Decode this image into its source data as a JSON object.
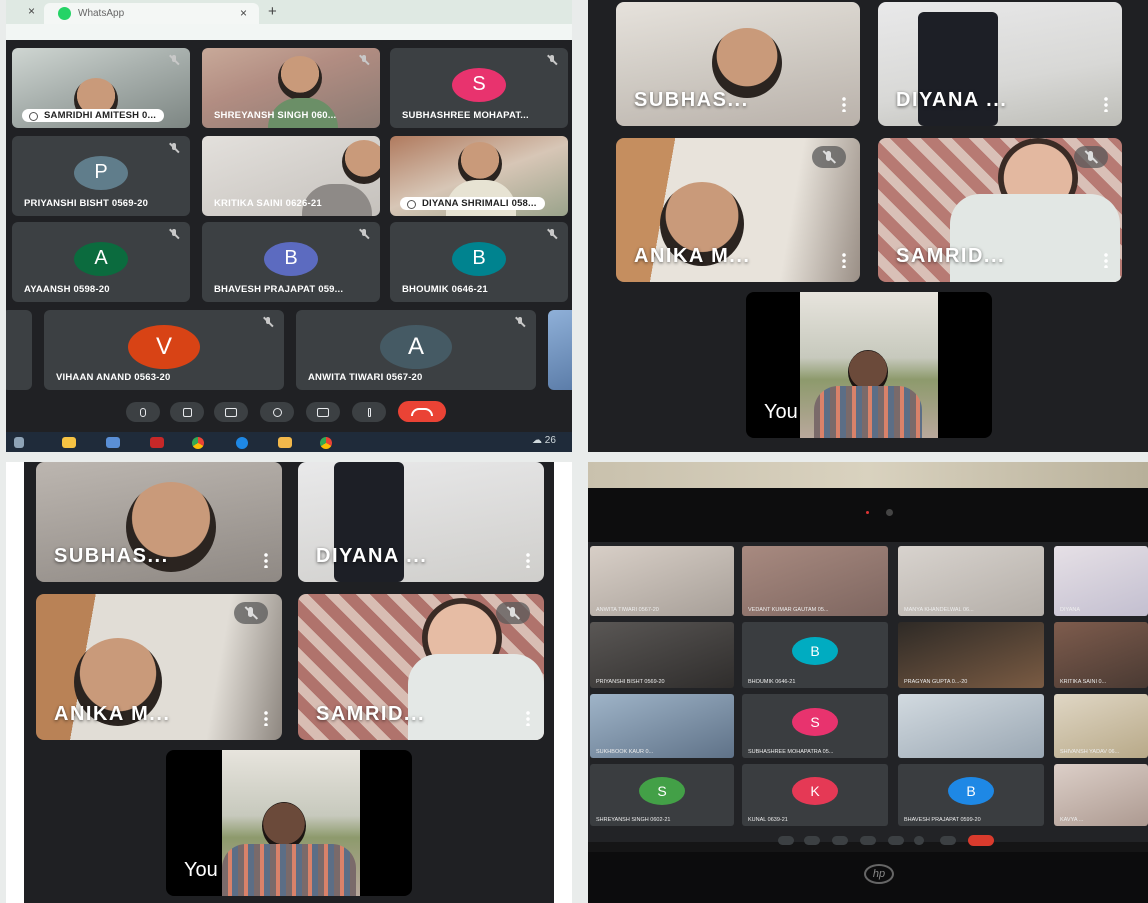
{
  "browser": {
    "tab_title": "WhatsApp",
    "new_tab": "+",
    "close_tab": "×"
  },
  "meet_grid": {
    "participants": [
      {
        "name": "SAMRIDHI AMITESH 0...",
        "avatar": "",
        "color": ""
      },
      {
        "name": "SHREYANSH SINGH 060...",
        "avatar": "",
        "color": ""
      },
      {
        "name": "SUBHASHREE MOHAPAT...",
        "avatar": "S",
        "color": "#e8336e"
      },
      {
        "name": "PRIYANSHI BISHT 0569-20",
        "avatar": "P",
        "color": "#607d8b"
      },
      {
        "name": "KRITIKA SAINI 0626-21",
        "avatar": "",
        "color": ""
      },
      {
        "name": "DIYANA SHRIMALI 058...",
        "avatar": "",
        "color": ""
      },
      {
        "name": "AYAANSH 0598-20",
        "avatar": "A",
        "color": "#0b6b3e"
      },
      {
        "name": "BHAVESH PRAJAPAT 059...",
        "avatar": "B",
        "color": "#5c6bc0"
      },
      {
        "name": "BHOUMIK 0646-21",
        "avatar": "B",
        "color": "#00838f"
      },
      {
        "name": "VIHAAN ANAND 0563-20",
        "avatar": "V",
        "color": "#d84315"
      },
      {
        "name": "ANWITA TIWARI 0567-20",
        "avatar": "A",
        "color": "#455a64"
      }
    ],
    "taskbar_weather": "26"
  },
  "phone_a": {
    "tiles": [
      {
        "name": "SUBHAS..."
      },
      {
        "name": "DIYANA ..."
      },
      {
        "name": "ANIKA M..."
      },
      {
        "name": "SAMRID..."
      }
    ],
    "self_label": "You"
  },
  "phone_b": {
    "tiles": [
      {
        "name": "SUBHAS..."
      },
      {
        "name": "DIYANA ..."
      },
      {
        "name": "ANIKA M..."
      },
      {
        "name": "SAMRID..."
      }
    ],
    "self_label": "You"
  },
  "laptop": {
    "participants": [
      {
        "name": "ANWITA TIWARI 0567-20",
        "avatar": ""
      },
      {
        "name": "VEDANT KUMAR GAUTAM 05...",
        "avatar": ""
      },
      {
        "name": "MANYA KHANDELWAL 06...",
        "avatar": ""
      },
      {
        "name": "DIYANA",
        "avatar": ""
      },
      {
        "name": "PRIYANSHI BISHT 0569-20",
        "avatar": ""
      },
      {
        "name": "BHOUMIK 0646-21",
        "avatar": "B"
      },
      {
        "name": "PRAGYAN GUPTA 0...-20",
        "avatar": ""
      },
      {
        "name": "KRITIKA SAINI 0...",
        "avatar": ""
      },
      {
        "name": "SUKHBOOK KAUR 0...",
        "avatar": ""
      },
      {
        "name": "SUBHASHREE MOHAPATRA 05...",
        "avatar": "S"
      },
      {
        "name": "",
        "avatar": ""
      },
      {
        "name": "SHIVANSH YADAV 06...",
        "avatar": ""
      },
      {
        "name": "SHREYANSH SINGH 0602-21",
        "avatar": "S"
      },
      {
        "name": "KUNAL 0639-21",
        "avatar": "K"
      },
      {
        "name": "BHAVESH PRAJAPAT 0599-20",
        "avatar": "B"
      },
      {
        "name": "KAVYA ...",
        "avatar": ""
      }
    ],
    "brand": "hp"
  }
}
